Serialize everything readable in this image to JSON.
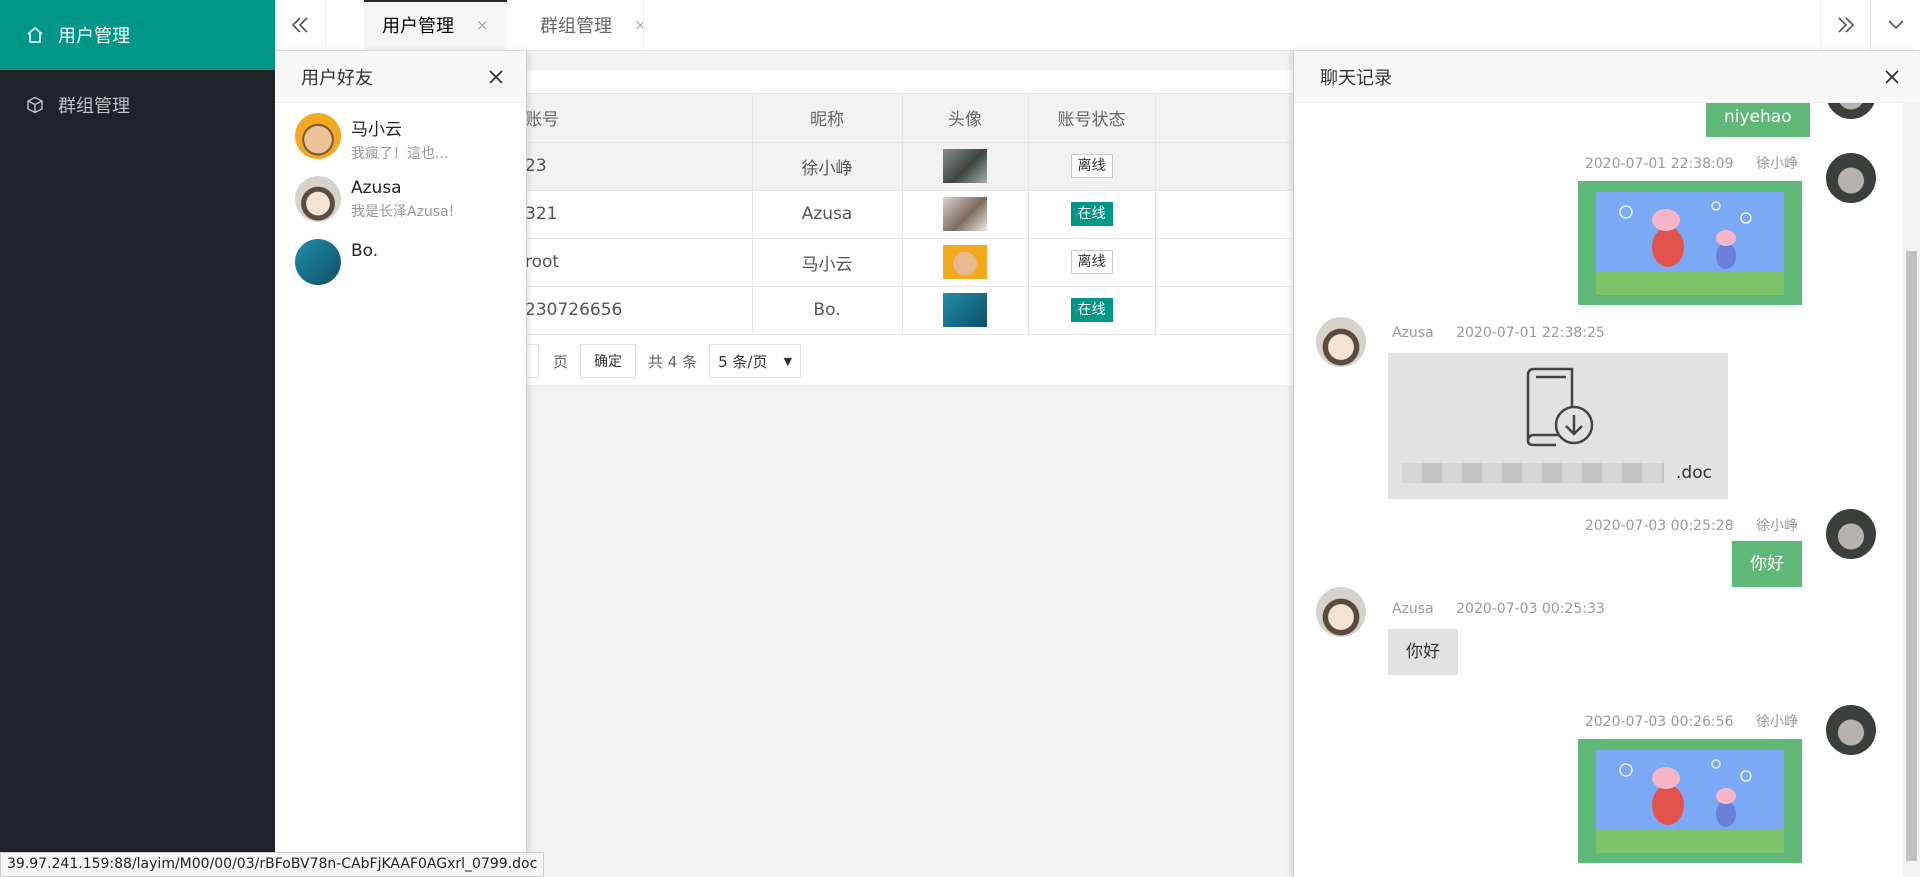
{
  "sidebar": {
    "items": [
      {
        "label": "用户管理",
        "icon": "home-icon"
      },
      {
        "label": "群组管理",
        "icon": "cube-icon"
      }
    ]
  },
  "tabs": [
    {
      "label": "用户管理",
      "close": "×"
    },
    {
      "label": "群组管理",
      "close": "×"
    }
  ],
  "table": {
    "headers": [
      "账号",
      "昵称",
      "头像",
      "账号状态"
    ],
    "rows": [
      {
        "id": "23",
        "nick": "徐小峥",
        "status": "离线",
        "online": false
      },
      {
        "id": "321",
        "nick": "Azusa",
        "status": "在线",
        "online": true
      },
      {
        "id": "root",
        "nick": "马小云",
        "status": "离线",
        "online": false
      },
      {
        "id": "230726656",
        "nick": "Bo.",
        "status": "在线",
        "online": true
      }
    ],
    "pager": {
      "page_suffix": "页",
      "confirm": "确定",
      "total": "共 4 条",
      "page_size": "5 条/页"
    }
  },
  "friends": {
    "title": "用户好友",
    "items": [
      {
        "name": "马小云",
        "sign": "我瘋了！這也..."
      },
      {
        "name": "Azusa",
        "sign": "我是长泽Azusa!"
      },
      {
        "name": "Bo.",
        "sign": ""
      }
    ]
  },
  "chat": {
    "title": "聊天记录",
    "messages": [
      {
        "text": "niyehao"
      },
      {
        "time": "2020-07-01 22:38:09",
        "user": "徐小峥"
      },
      {
        "time": "2020-07-01 22:38:25",
        "user": "Azusa",
        "file_ext": ".doc"
      },
      {
        "time": "2020-07-03 00:25:28",
        "user": "徐小峥",
        "text": "你好"
      },
      {
        "time": "2020-07-03 00:25:33",
        "user": "Azusa",
        "text": "你好"
      },
      {
        "time": "2020-07-03 00:26:56",
        "user": "徐小峥"
      }
    ]
  },
  "status_url": "39.97.241.159:88/layim/M00/00/03/rBFoBV78n-CAbFjKAAF0AGxrl_0799.doc"
}
